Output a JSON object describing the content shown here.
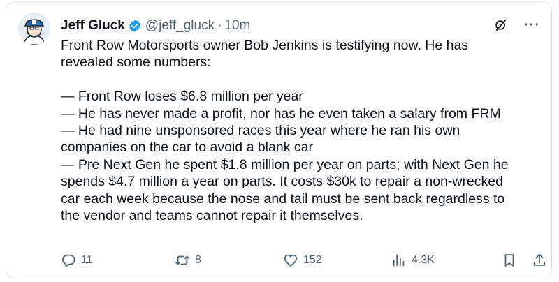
{
  "author": {
    "name": "Jeff Gluck",
    "handle": "@jeff_gluck",
    "separator": "·",
    "time": "10m"
  },
  "colors": {
    "verified": "#1d9bf0",
    "text": "#0f1419",
    "secondary": "#536471",
    "border": "#e3e7ea"
  },
  "icons": {
    "verified": "verified-badge-icon",
    "grok": "grok-icon",
    "more": "more-icon",
    "reply": "reply-icon",
    "retweet": "retweet-icon",
    "like": "heart-icon",
    "views": "views-icon",
    "bookmark": "bookmark-icon",
    "share": "share-icon"
  },
  "header": {
    "more_glyph": "···"
  },
  "tweet": {
    "lines": [
      "Front Row Motorsports owner Bob Jenkins is testifying now. He has",
      "revealed some numbers:",
      "",
      "— Front Row loses $6.8 million per year",
      "— He has never made a profit, nor has he even taken a salary from FRM",
      "— He had nine unsponsored races this year where he ran his own",
      "companies on the car to avoid a blank car",
      "— Pre Next Gen he spent $1.8 million per year on parts; with Next Gen he",
      "spends $4.7 million a year on parts. It costs $30k to repair a non-wrecked",
      "car each week because the nose and tail must be sent back regardless to",
      "the vendor and teams cannot repair it themselves."
    ]
  },
  "stats": {
    "replies": "11",
    "retweets": "8",
    "likes": "152",
    "views": "4.3K"
  }
}
